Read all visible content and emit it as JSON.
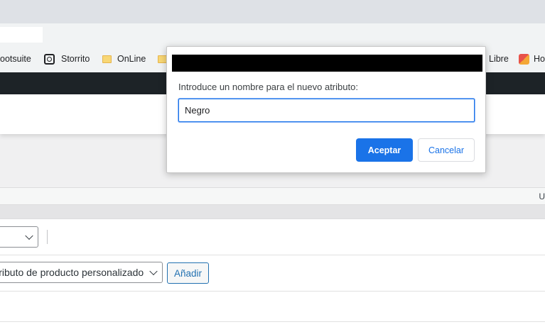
{
  "bookmarks": {
    "items": [
      {
        "label": "Hootsuite",
        "icon": "hootsuite-icon"
      },
      {
        "label": "Storrito",
        "icon": "storrito-icon"
      },
      {
        "label": "OnLine",
        "icon": "folder-icon"
      },
      {
        "label": "Libre",
        "icon": "folder-icon"
      },
      {
        "label": "Ho",
        "icon": "favicon-icon"
      }
    ]
  },
  "metabox": {
    "header_right": "U",
    "attribute_select": {
      "value": "Atributo de producto personalizado"
    },
    "add_button": "Añadir",
    "row_label": "r"
  },
  "dialog": {
    "title": "",
    "message": "Introduce un nombre para el nuevo atributo:",
    "input_value": "Negro",
    "accept_label": "Aceptar",
    "cancel_label": "Cancelar"
  },
  "colors": {
    "accent": "#1a73e8",
    "admin_bar": "#1d2327",
    "wp_link": "#2271b1"
  }
}
